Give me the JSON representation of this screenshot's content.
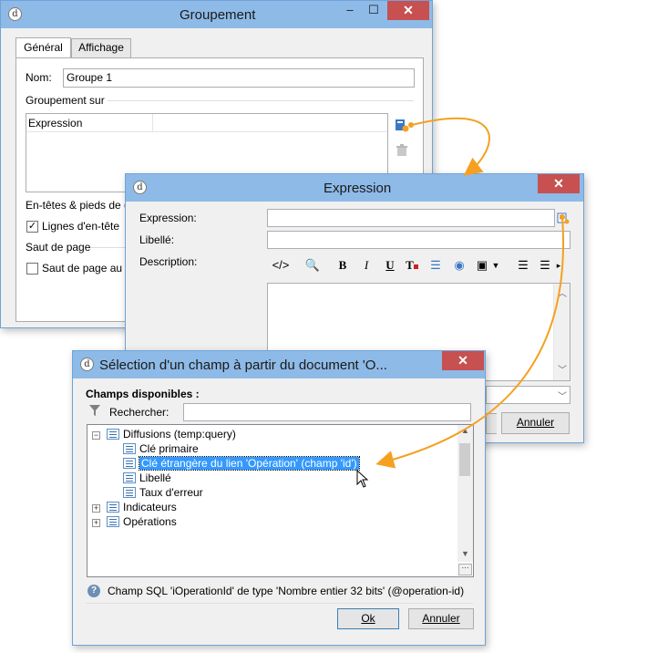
{
  "groupement": {
    "title": "Groupement",
    "tabs": [
      "Général",
      "Affichage"
    ],
    "nom_label": "Nom:",
    "nom_value": "Groupe 1",
    "groupement_sur_label": "Groupement sur",
    "list_header": "Expression",
    "entetes_label": "En-têtes & pieds de g",
    "lignes_entete_label": "Lignes d'en-tête",
    "lignes_entete_checked": true,
    "saut_label": "Saut de page",
    "saut_checkbox_label": "Saut de page au d",
    "saut_checked": false
  },
  "expression": {
    "title": "Expression",
    "expression_label": "Expression:",
    "libelle_label": "Libellé:",
    "description_label": "Description:",
    "annuler_label": "Annuler"
  },
  "selection": {
    "title": "Sélection d'un champ à partir du document 'O...",
    "champs_label": "Champs disponibles :",
    "rechercher_label": "Rechercher:",
    "tree": [
      {
        "label": "Diffusions (temp:query)",
        "level": 0,
        "expander": "−"
      },
      {
        "label": "Clé primaire",
        "level": 1
      },
      {
        "label": "Clé étrangère du lien 'Opération' (champ 'id')",
        "level": 1,
        "selected": true
      },
      {
        "label": "Libellé",
        "level": 1
      },
      {
        "label": "Taux d'erreur",
        "level": 1
      },
      {
        "label": "Indicateurs",
        "level": 0,
        "expander": "+"
      },
      {
        "label": "Opérations",
        "level": 0,
        "expander": "+"
      }
    ],
    "status_text": "Champ SQL 'iOperationId' de type 'Nombre entier 32 bits' (@operation-id)",
    "ok_label": "Ok",
    "annuler_label": "Annuler"
  },
  "colors": {
    "titlebar": "#8ebae7",
    "close": "#c75050",
    "arrow": "#f5a020",
    "selection": "#3399ff"
  }
}
